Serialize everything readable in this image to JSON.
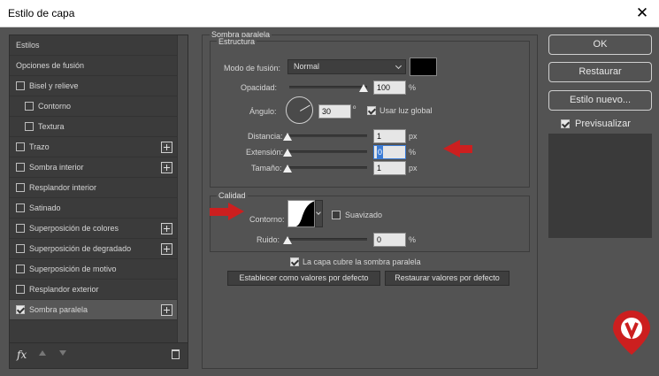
{
  "window": {
    "title": "Estilo de capa",
    "close_glyph": "✕"
  },
  "sidebar": {
    "items": [
      {
        "label": "Estilos",
        "has_checkbox": false,
        "checked": false,
        "indent": 0,
        "plus": false
      },
      {
        "label": "Opciones de fusión",
        "has_checkbox": false,
        "checked": false,
        "indent": 0,
        "plus": false
      },
      {
        "label": "Bisel y relieve",
        "has_checkbox": true,
        "checked": false,
        "indent": 0,
        "plus": false
      },
      {
        "label": "Contorno",
        "has_checkbox": true,
        "checked": false,
        "indent": 1,
        "plus": false
      },
      {
        "label": "Textura",
        "has_checkbox": true,
        "checked": false,
        "indent": 1,
        "plus": false
      },
      {
        "label": "Trazo",
        "has_checkbox": true,
        "checked": false,
        "indent": 0,
        "plus": true
      },
      {
        "label": "Sombra interior",
        "has_checkbox": true,
        "checked": false,
        "indent": 0,
        "plus": true
      },
      {
        "label": "Resplandor interior",
        "has_checkbox": true,
        "checked": false,
        "indent": 0,
        "plus": false
      },
      {
        "label": "Satinado",
        "has_checkbox": true,
        "checked": false,
        "indent": 0,
        "plus": false
      },
      {
        "label": "Superposición de colores",
        "has_checkbox": true,
        "checked": false,
        "indent": 0,
        "plus": true
      },
      {
        "label": "Superposición de degradado",
        "has_checkbox": true,
        "checked": false,
        "indent": 0,
        "plus": true
      },
      {
        "label": "Superposición de motivo",
        "has_checkbox": true,
        "checked": false,
        "indent": 0,
        "plus": false
      },
      {
        "label": "Resplandor exterior",
        "has_checkbox": true,
        "checked": false,
        "indent": 0,
        "plus": false
      },
      {
        "label": "Sombra paralela",
        "has_checkbox": true,
        "checked": true,
        "indent": 0,
        "plus": true,
        "selected": true
      }
    ],
    "bottom": {
      "fx_label": "fx"
    }
  },
  "panel": {
    "title": "Sombra paralela",
    "structure": {
      "title": "Estructura",
      "blend_mode_label": "Modo de fusión:",
      "blend_mode_value": "Normal",
      "shadow_color": "#000000",
      "opacity_label": "Opacidad:",
      "opacity_value": "100",
      "opacity_unit": "%",
      "opacity_level": 1.0,
      "angle_label": "Ángulo:",
      "angle_value": "30",
      "angle_unit": "º",
      "global_light_label": "Usar luz global",
      "global_light_checked": true,
      "distance_label": "Distancia:",
      "distance_value": "1",
      "distance_unit": "px",
      "spread_label": "Extensión:",
      "spread_value": "0",
      "spread_unit": "%",
      "size_label": "Tamaño:",
      "size_value": "1",
      "size_unit": "px"
    },
    "quality": {
      "title": "Calidad",
      "contour_label": "Contorno:",
      "antialiased_label": "Suavizado",
      "antialiased_checked": false,
      "noise_label": "Ruido:",
      "noise_value": "0",
      "noise_unit": "%"
    },
    "knockout_label": "La capa cubre la sombra paralela",
    "knockout_checked": true,
    "make_default_label": "Establecer como valores por defecto",
    "reset_default_label": "Restaurar valores por defecto"
  },
  "right": {
    "ok_label": "OK",
    "restore_label": "Restaurar",
    "new_style_label": "Estilo nuevo...",
    "preview_label": "Previsualizar",
    "preview_checked": true
  },
  "colors": {
    "accent_arrow": "#cc1f1f",
    "focus": "#3a7bd5"
  }
}
